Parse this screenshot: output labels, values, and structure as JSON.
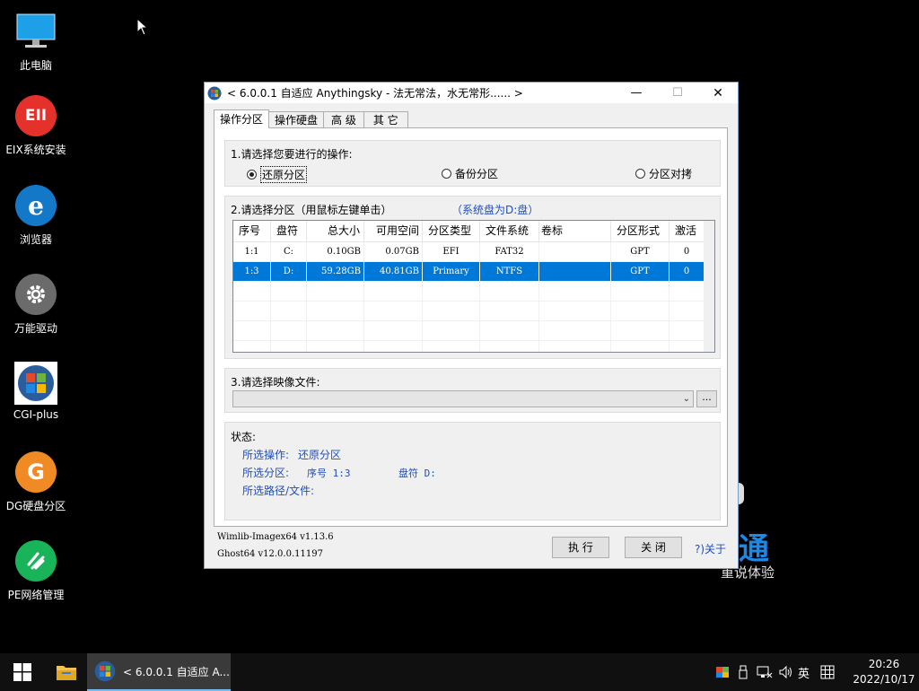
{
  "desktop": {
    "icons": [
      {
        "label": "此电脑"
      },
      {
        "label": "EIX系统安装",
        "badge": "EII"
      },
      {
        "label": "浏览器",
        "badge": "e"
      },
      {
        "label": "万能驱动"
      },
      {
        "label": "CGI-plus"
      },
      {
        "label": "DG硬盘分区",
        "badge": "G"
      },
      {
        "label": "PE网络管理"
      }
    ],
    "bg_text_big": "通",
    "bg_text_small": "重说体验"
  },
  "window": {
    "title": "< 6.0.0.1 自适应 Anythingsky - 法无常法，水无常形...... >",
    "controls": {
      "minimize": "—",
      "maximize": "☐",
      "close": "✕"
    },
    "tabs": [
      "操作分区",
      "操作硬盘",
      "高 级",
      "其 它"
    ],
    "op_group": {
      "title": "1.请选择您要进行的操作:",
      "options": [
        "还原分区",
        "备份分区",
        "分区对拷"
      ],
      "selected": 0
    },
    "part_group": {
      "title": "2.请选择分区（用鼠标左键单击）",
      "system_hint": "（系统盘为D:盘）",
      "columns": [
        "序号",
        "盘符",
        "总大小",
        "可用空间",
        "分区类型",
        "文件系统",
        "卷标",
        "分区形式",
        "激活"
      ],
      "rows": [
        [
          "1:1",
          "C:",
          "0.10GB",
          "0.07GB",
          "EFI",
          "FAT32",
          "",
          "GPT",
          "0"
        ],
        [
          "1:3",
          "D:",
          "59.28GB",
          "40.81GB",
          "Primary",
          "NTFS",
          "",
          "GPT",
          "0"
        ]
      ],
      "selected_row": 1
    },
    "image_group": {
      "title": "3.请选择映像文件:",
      "value": "",
      "browse_label": "..."
    },
    "status": {
      "title": "状态:",
      "op_label": "所选操作:",
      "op_value": "还原分区",
      "part_label": "所选分区:",
      "part_seq": "序号 1:3",
      "part_drive": "盘符 D:",
      "path_label": "所选路径/文件:"
    },
    "versions": [
      "Wimlib-Imagex64 v1.13.6",
      "Ghost64 v12.0.0.11197"
    ],
    "buttons": {
      "execute": "执 行",
      "close": "关 闭",
      "about": "?)关于"
    }
  },
  "taskbar": {
    "task_label": "< 6.0.0.1 自适应 A...",
    "ime": "英",
    "time": "20:26",
    "date": "2022/10/17"
  },
  "colors": {
    "selection": "#0078d7",
    "accent_blue": "#1e4fc0",
    "taskbar": "#101010"
  }
}
